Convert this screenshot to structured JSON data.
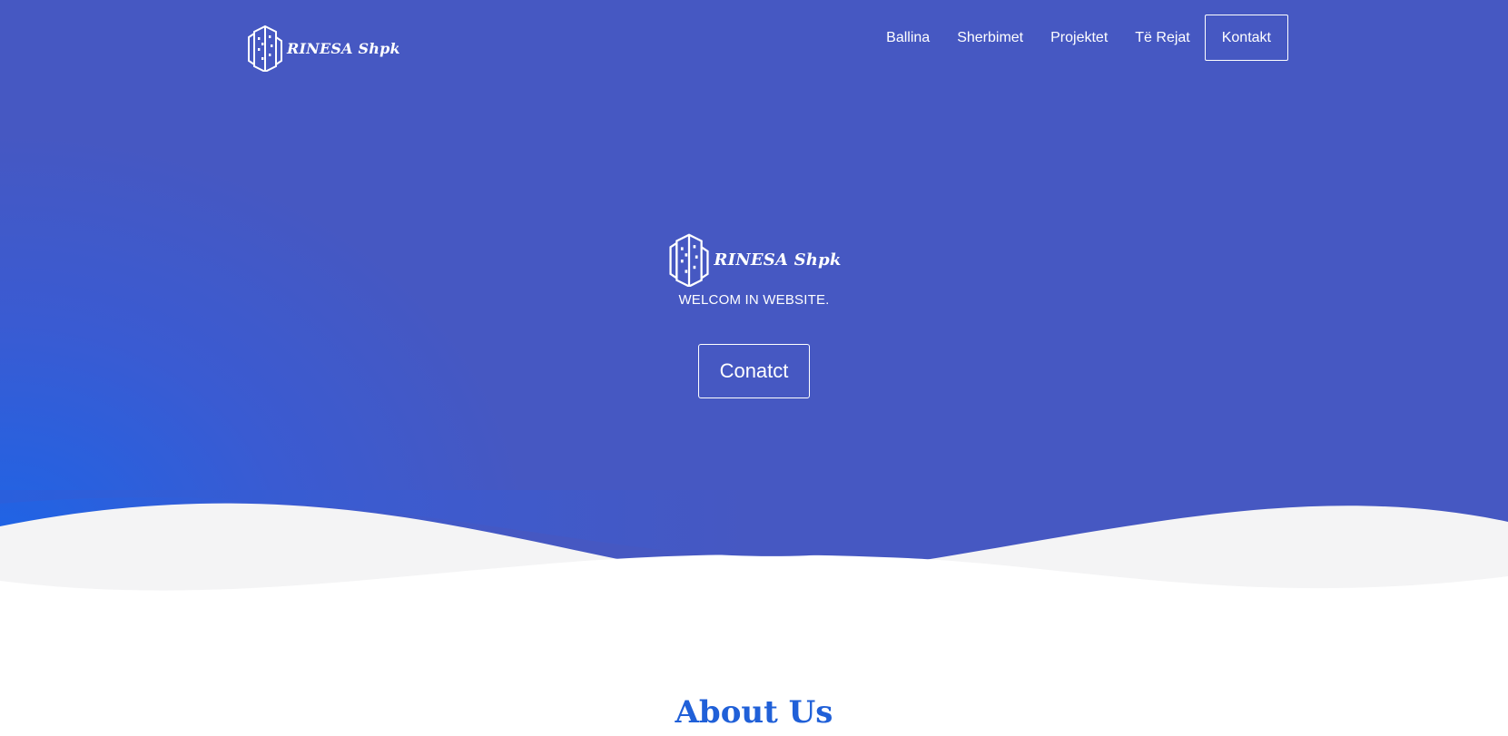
{
  "brand": {
    "name": "RINESA Shpk",
    "logo_icon": "building-icon"
  },
  "nav": {
    "items": [
      {
        "label": "Ballina"
      },
      {
        "label": "Sherbimet"
      },
      {
        "label": "Projektet"
      },
      {
        "label": "Të Rejat"
      }
    ],
    "cta_label": "Kontakt"
  },
  "hero": {
    "brand_name": "RINESA Shpk",
    "tagline": "WELCOM IN WEBSITE.",
    "button_label": "Conatct"
  },
  "about": {
    "title": "About Us"
  },
  "colors": {
    "hero_background": "#4658c2",
    "hero_gradient_accent": "#1e64e6",
    "wave_light": "#f4f4f5",
    "heading": "#2060d8",
    "text_on_hero": "#ffffff"
  }
}
